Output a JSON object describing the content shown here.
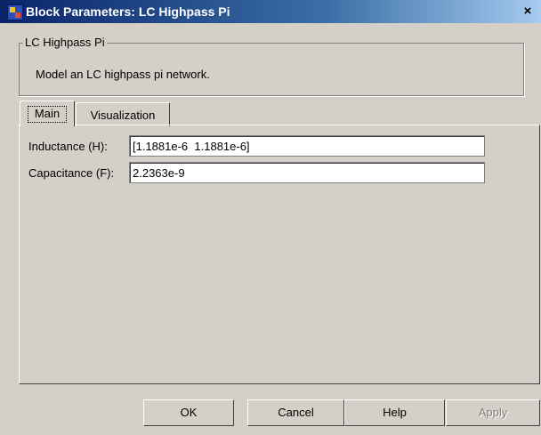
{
  "window": {
    "title": "Block Parameters: LC Highpass Pi",
    "close_label": "×"
  },
  "group": {
    "title": "LC Highpass Pi",
    "description": "Model an LC highpass pi network."
  },
  "tabs": [
    {
      "label": "Main",
      "active": true
    },
    {
      "label": "Visualization",
      "active": false
    }
  ],
  "fields": {
    "inductance": {
      "label": "Inductance (H):",
      "value": "[1.1881e-6  1.1881e-6]"
    },
    "capacitance": {
      "label": "Capacitance (F):",
      "value": "2.2363e-9"
    }
  },
  "buttons": {
    "ok": "OK",
    "cancel": "Cancel",
    "help": "Help",
    "apply": "Apply"
  },
  "icons": {
    "app": "matlab-block-icon",
    "close": "close-icon"
  },
  "colors": {
    "titlebar_start": "#0a246a",
    "titlebar_end": "#a6caf0",
    "dialog_bg": "#d4d0c8"
  }
}
